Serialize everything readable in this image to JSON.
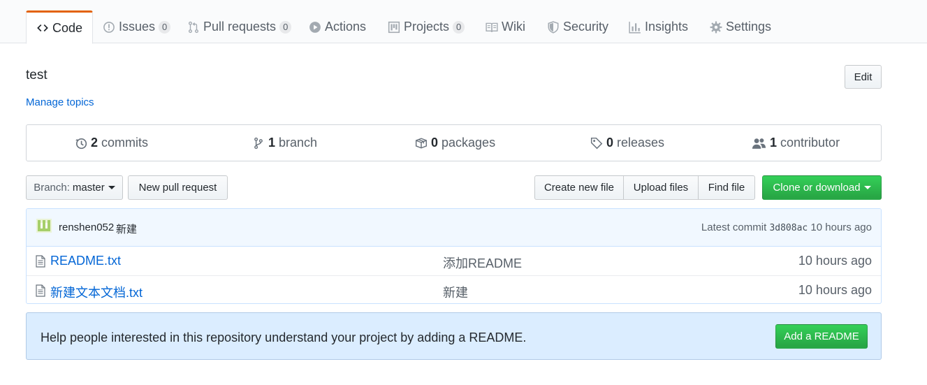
{
  "tabs": [
    {
      "label": "Code",
      "icon": "code-icon",
      "selected": true
    },
    {
      "label": "Issues",
      "icon": "issue-opened-icon",
      "counter": "0"
    },
    {
      "label": "Pull requests",
      "icon": "git-pull-request-icon",
      "counter": "0"
    },
    {
      "label": "Actions",
      "icon": "play-icon"
    },
    {
      "label": "Projects",
      "icon": "project-icon",
      "counter": "0"
    },
    {
      "label": "Wiki",
      "icon": "book-icon"
    },
    {
      "label": "Security",
      "icon": "shield-icon"
    },
    {
      "label": "Insights",
      "icon": "graph-icon"
    },
    {
      "label": "Settings",
      "icon": "gear-icon"
    }
  ],
  "repo": {
    "description": "test",
    "manage_topics": "Manage topics",
    "edit_label": "Edit"
  },
  "summary": {
    "commits": {
      "count": "2",
      "label": "commits"
    },
    "branches": {
      "count": "1",
      "label": "branch"
    },
    "packages": {
      "count": "0",
      "label": "packages"
    },
    "releases": {
      "count": "0",
      "label": "releases"
    },
    "contributors": {
      "count": "1",
      "label": "contributor"
    }
  },
  "file_nav": {
    "branch_prefix": "Branch:",
    "branch_name": "master",
    "new_pull_request": "New pull request",
    "create_new_file": "Create new file",
    "upload_files": "Upload files",
    "find_file": "Find file",
    "clone_or_download": "Clone or download"
  },
  "latest_commit": {
    "author": "renshen052",
    "message": "新建",
    "prefix": "Latest commit",
    "sha": "3d808ac",
    "age": "10 hours ago"
  },
  "files": [
    {
      "name": "README.txt",
      "message": "添加README",
      "age": "10 hours ago"
    },
    {
      "name": "新建文本文档.txt",
      "message": "新建",
      "age": "10 hours ago"
    }
  ],
  "readme_prompt": {
    "text": "Help people interested in this repository understand your project by adding a README.",
    "button": "Add a README"
  },
  "colors": {
    "accent_tab": "#e36209",
    "link": "#0366d6",
    "primary_button": "#28a745",
    "tease_bg": "#f1f8ff",
    "readme_bg": "#dbedff"
  }
}
